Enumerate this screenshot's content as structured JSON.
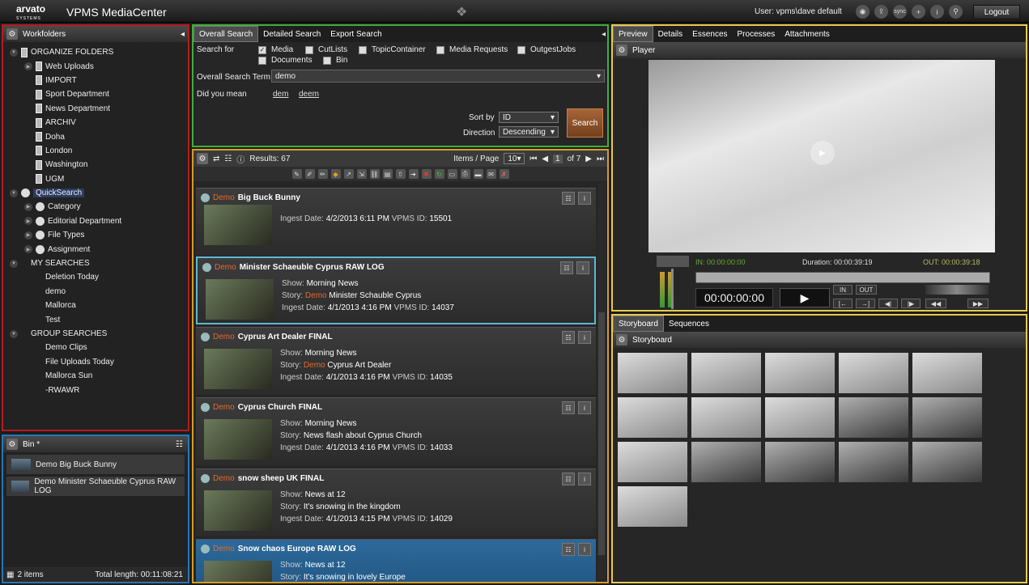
{
  "app": {
    "brand": "arvato",
    "brand_sub": "SYSTEMS",
    "title": "VPMS MediaCenter",
    "user": "User:  vpms\\dave default",
    "logout": "Logout",
    "top_icons": [
      "eye-icon",
      "upload-icon",
      "sync-icon",
      "add-icon",
      "info-icon",
      "search-icon"
    ],
    "sync_label": "sync"
  },
  "workfolders": {
    "title": "Workfolders",
    "items": [
      {
        "label": "ORGANIZE FOLDERS",
        "level": 0,
        "type": "folder",
        "expander": "open"
      },
      {
        "label": "Web Uploads",
        "level": 1,
        "type": "folder",
        "expander": "closed"
      },
      {
        "label": "IMPORT",
        "level": 1,
        "type": "folder",
        "expander": "none"
      },
      {
        "label": "Sport Department",
        "level": 1,
        "type": "folder",
        "expander": "none"
      },
      {
        "label": "News Department",
        "level": 1,
        "type": "folder",
        "expander": "none"
      },
      {
        "label": "ARCHIV",
        "level": 1,
        "type": "folder",
        "expander": "none"
      },
      {
        "label": "Doha",
        "level": 1,
        "type": "folder",
        "expander": "none"
      },
      {
        "label": "London",
        "level": 1,
        "type": "folder",
        "expander": "none"
      },
      {
        "label": "Washington",
        "level": 1,
        "type": "folder",
        "expander": "none"
      },
      {
        "label": "UGM",
        "level": 1,
        "type": "folder",
        "expander": "none"
      },
      {
        "label": "QuickSearch",
        "level": 0,
        "type": "circle",
        "expander": "open",
        "selected": true
      },
      {
        "label": "Category",
        "level": 1,
        "type": "circle",
        "expander": "closed"
      },
      {
        "label": "Editorial Department",
        "level": 1,
        "type": "circle",
        "expander": "closed"
      },
      {
        "label": "File Types",
        "level": 1,
        "type": "circle",
        "expander": "closed"
      },
      {
        "label": "Assignment",
        "level": 1,
        "type": "circle",
        "expander": "closed"
      },
      {
        "label": "MY SEARCHES",
        "level": 0,
        "type": "none",
        "expander": "open"
      },
      {
        "label": "Deletion Today",
        "level": 1,
        "type": "none",
        "expander": "none"
      },
      {
        "label": "demo",
        "level": 1,
        "type": "none",
        "expander": "none"
      },
      {
        "label": "Mallorca",
        "level": 1,
        "type": "none",
        "expander": "none"
      },
      {
        "label": "Test",
        "level": 1,
        "type": "none",
        "expander": "none"
      },
      {
        "label": "GROUP SEARCHES",
        "level": 0,
        "type": "none",
        "expander": "open"
      },
      {
        "label": "Demo Clips",
        "level": 1,
        "type": "none",
        "expander": "none"
      },
      {
        "label": "File Uploads Today",
        "level": 1,
        "type": "none",
        "expander": "none"
      },
      {
        "label": "Mallorca Sun",
        "level": 1,
        "type": "none",
        "expander": "none"
      },
      {
        "label": "-RWAWR",
        "level": 1,
        "type": "none",
        "expander": "none"
      }
    ]
  },
  "bin": {
    "title": "Bin *",
    "items": [
      "Demo Big Buck Bunny",
      "Demo Minister Schaeuble Cyprus RAW LOG"
    ],
    "count": "2 items",
    "length": "Total length: 00:11:08:21"
  },
  "search": {
    "tabs": [
      "Overall Search",
      "Detailed Search",
      "Export Search"
    ],
    "search_for_label": "Search for",
    "checkboxes": [
      {
        "label": "Media",
        "checked": true
      },
      {
        "label": "CutLists",
        "checked": false
      },
      {
        "label": "TopicContainer",
        "checked": false
      },
      {
        "label": "Media Requests",
        "checked": false
      },
      {
        "label": "OutgestJobs",
        "checked": false
      },
      {
        "label": "Documents",
        "checked": false
      },
      {
        "label": "Bin",
        "checked": false
      }
    ],
    "term_label": "Overall Search Term",
    "term_value": "demo",
    "didyoumean_label": "Did you mean",
    "suggestions": [
      "dem",
      "deem"
    ],
    "sortby_label": "Sort by",
    "sortby_value": "ID",
    "direction_label": "Direction",
    "direction_value": "Descending",
    "button": "Search"
  },
  "results": {
    "count": "Results: 67",
    "items_per_page_label": "Items / Page",
    "items_per_page": "10",
    "page": "1",
    "of": "of 7",
    "cards": [
      {
        "prefix": "Demo",
        "title": "Big Buck Bunny",
        "show": "",
        "story_prefix": "",
        "story": "",
        "ingest": "4/2/2013 6:11 PM",
        "vpms_id": "15501"
      },
      {
        "prefix": "Demo",
        "title": "Minister Schaeuble Cyprus RAW LOG",
        "show": "Morning News",
        "story_prefix": "Demo",
        "story": "Minister Schauble Cyprus",
        "ingest": "4/1/2013 4:16 PM",
        "vpms_id": "14037"
      },
      {
        "prefix": "Demo",
        "title": "Cyprus Art Dealer FINAL",
        "show": "Morning News",
        "story_prefix": "Demo",
        "story": "Cyprus Art Dealer",
        "ingest": "4/1/2013 4:16 PM",
        "vpms_id": "14035"
      },
      {
        "prefix": "Demo",
        "title": "Cyprus Church FINAL",
        "show": "Morning News",
        "story_prefix": "",
        "story": "News flash about Cyprus Church",
        "ingest": "4/1/2013 4:16 PM",
        "vpms_id": "14033"
      },
      {
        "prefix": "Demo",
        "title": "snow sheep UK FINAL",
        "show": "News at 12",
        "story_prefix": "",
        "story": "It's snowing in the kingdom",
        "ingest": "4/1/2013 4:15 PM",
        "vpms_id": "14029"
      },
      {
        "prefix": "Demo",
        "title": "Snow chaos Europe RAW LOG",
        "show": "News at 12",
        "story_prefix": "",
        "story": "It's snowing in lovely Europe",
        "ingest": "",
        "vpms_id": ""
      }
    ],
    "labels": {
      "show": "Show:",
      "story": "Story:",
      "ingest": "Ingest Date:",
      "vpms": "VPMS ID:"
    }
  },
  "preview": {
    "tabs": [
      "Preview",
      "Details",
      "Essences",
      "Processes",
      "Attachments"
    ],
    "player_title": "Player",
    "in": "IN: 00:00:00:00",
    "duration": "Duration: 00:00:39:19",
    "out": "OUT: 00:00:39:18",
    "timecode": "00:00:00:00",
    "in_btn": "IN",
    "out_btn": "OUT"
  },
  "storyboard": {
    "tabs": [
      "Storyboard",
      "Sequences"
    ],
    "title": "Storyboard",
    "frames": 16
  },
  "colors": {
    "workfolders_border": "#b51b22",
    "search_border": "#3fae3a",
    "results_border": "#d99a23",
    "preview_border": "#e8c94e",
    "bin_border": "#2777b5",
    "accent_orange": "#e26b2e"
  }
}
